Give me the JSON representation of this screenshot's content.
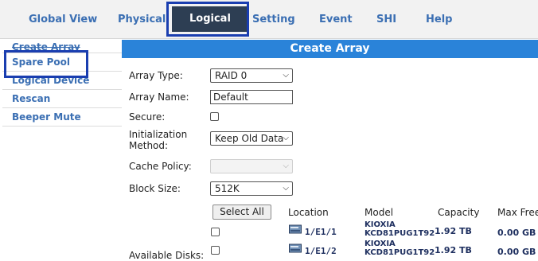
{
  "nav": {
    "tabs": [
      "Global View",
      "Physical",
      "Logical",
      "Setting",
      "Event",
      "SHI",
      "Help"
    ],
    "active": "Logical"
  },
  "sidebar": {
    "items": [
      "Create Array",
      "Spare Pool",
      "Logical Device",
      "Rescan",
      "Beeper Mute"
    ]
  },
  "main": {
    "title": "Create Array",
    "array_type": {
      "label": "Array Type:",
      "value": "RAID 0"
    },
    "array_name": {
      "label": "Array Name:",
      "value": "Default"
    },
    "secure": {
      "label": "Secure:",
      "checked": false
    },
    "init_method": {
      "label_line1": "Initialization",
      "label_line2": "Method:",
      "value": "Keep Old Data"
    },
    "cache_policy": {
      "label": "Cache Policy:",
      "value": ""
    },
    "block_size": {
      "label": "Block Size:",
      "value": "512K"
    },
    "select_all_label": "Select All",
    "available_disks_label": "Available Disks:",
    "columns": {
      "location": "Location",
      "model": "Model",
      "capacity": "Capacity",
      "max_free": "Max Free"
    },
    "disks": [
      {
        "location": "1/E1/1",
        "model_line1": "KIOXIA",
        "model_line2": "KCD81PUG1T92",
        "capacity": "1.92 TB",
        "max_free": "0.00 GB"
      },
      {
        "location": "1/E1/2",
        "model_line1": "KIOXIA",
        "model_line2": "KCD81PUG1T92",
        "capacity": "1.92 TB",
        "max_free": "0.00 GB"
      }
    ]
  },
  "colors": {
    "nav_link": "#3b6fb3",
    "active_tab_bg": "#2d3e53",
    "header_bar": "#2a83d9",
    "highlight_box": "#1a3eb0",
    "disk_text": "#1e2f5f"
  }
}
